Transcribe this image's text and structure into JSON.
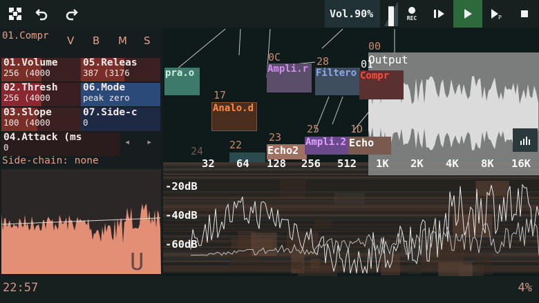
{
  "toolbar": {
    "volume_label": "Vol.90%",
    "volume_level": 0.9,
    "rec_label": "REC",
    "icons": [
      "menu-grid-icon",
      "undo-icon",
      "redo-icon",
      "record-icon",
      "play-pause-icon",
      "play-icon",
      "play-pattern-icon",
      "stop-icon",
      "hamburger-icon",
      "layers-icon",
      "select-icon"
    ]
  },
  "module": {
    "title": "01.Compr",
    "flags": [
      "V",
      "B",
      "M",
      "S"
    ],
    "controls": [
      {
        "name": "01.Volume",
        "value": "256 (4000",
        "fill": 0.5
      },
      {
        "name": "05.Releas",
        "value": "387 (3176",
        "fill": 0.55
      },
      {
        "name": "02.Thresh",
        "value": "256 (4000",
        "fill": 0.5
      },
      {
        "name": "06.Mode",
        "value": "peak zero",
        "fill": 1.0
      },
      {
        "name": "03.Slope",
        "value": "100 (4000",
        "fill": 0.45
      },
      {
        "name": "07.Side-c",
        "value": "0",
        "fill": 0.0
      },
      {
        "name": "04.Attack (ms",
        "value": "0",
        "fill": 0.0
      }
    ],
    "sidechain": "Side-chain: none",
    "scope_letter": "U"
  },
  "network": {
    "nodes": [
      {
        "num": "",
        "label": "pra.o"
      },
      {
        "num": "0C",
        "label": "Ampli.r"
      },
      {
        "num": "28",
        "label": "Filtero"
      },
      {
        "num": "01",
        "label": "Compr"
      },
      {
        "num": "00",
        "label": "Output"
      },
      {
        "num": "17",
        "label": "Analo.d"
      },
      {
        "num": "23",
        "label": "Echo2"
      },
      {
        "num": "25",
        "label": "Ampli.2"
      },
      {
        "num": "1D",
        "label": "Echo"
      },
      {
        "num": "24",
        "label": ""
      },
      {
        "num": "22",
        "label": ""
      }
    ]
  },
  "spectrum": {
    "freq_labels": [
      "32",
      "64",
      "128",
      "256",
      "512",
      "1K",
      "2K",
      "4K",
      "8K",
      "16K"
    ],
    "db_labels": [
      "-20dB",
      "-40dB",
      "-60dB"
    ]
  },
  "status": {
    "clock": "22:57",
    "cpu": "4%"
  },
  "colors": {
    "accent": "#e99f88",
    "play_active": "#2c6a3c",
    "volume_ctl": "#7a2e28",
    "thresh_ctl": "#8a2730",
    "mode_ctl": "#2b4a7a",
    "node_ampli": "#c478e0",
    "node_filter": "#7d9ae8",
    "node_compr": "#e83a3a",
    "node_analog": "#e0733b"
  }
}
